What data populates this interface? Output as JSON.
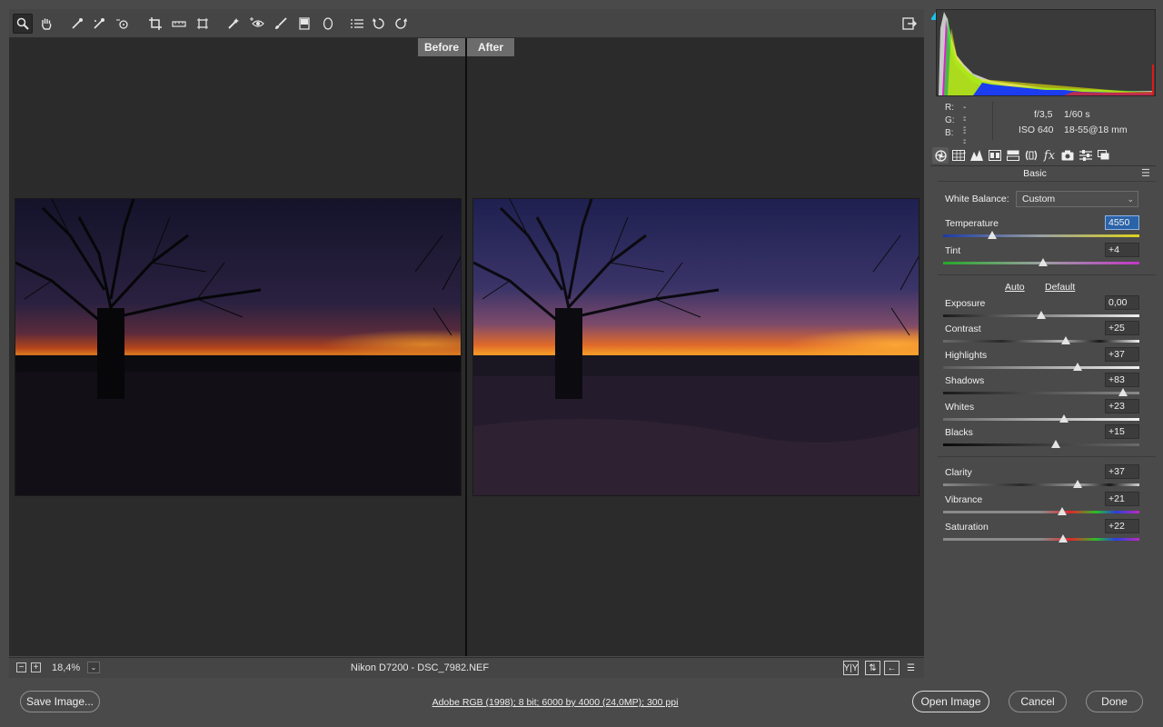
{
  "toolbar": {
    "tools": [
      {
        "name": "zoom-tool-icon",
        "glyph": "🔍",
        "active": true
      },
      {
        "name": "hand-tool-icon",
        "glyph": "✋"
      },
      {
        "name": "white-balance-tool-icon",
        "glyph": "⟋"
      },
      {
        "name": "color-sampler-tool-icon",
        "glyph": "⟋"
      },
      {
        "name": "targeted-adjustment-tool-icon",
        "glyph": "◎"
      },
      {
        "name": "crop-tool-icon",
        "glyph": "⌗"
      },
      {
        "name": "straighten-tool-icon",
        "glyph": "▭"
      },
      {
        "name": "transform-tool-icon",
        "glyph": "⬚"
      },
      {
        "name": "spot-removal-tool-icon",
        "glyph": "✎"
      },
      {
        "name": "red-eye-tool-icon",
        "glyph": "◉"
      },
      {
        "name": "adjustment-brush-icon",
        "glyph": "✐"
      },
      {
        "name": "graduated-filter-icon",
        "glyph": "▮"
      },
      {
        "name": "radial-filter-icon",
        "glyph": "◯"
      },
      {
        "name": "preferences-icon",
        "glyph": "☰"
      },
      {
        "name": "rotate-left-icon",
        "glyph": "↺"
      },
      {
        "name": "rotate-right-icon",
        "glyph": "↻"
      }
    ],
    "fullscreen_icon": "⇱"
  },
  "preview": {
    "before_label": "Before",
    "after_label": "After"
  },
  "statusbar": {
    "zoom_out": "−",
    "zoom_in": "+",
    "zoom_value": "18,4%",
    "zoom_dropdown": "⌄",
    "file_info": "Nikon D7200  -  DSC_7982.NEF",
    "view_buttons": [
      "Y|Y",
      "⇅",
      "←",
      "☰"
    ]
  },
  "camera": {
    "r_label": "R:",
    "r_value": "---",
    "g_label": "G:",
    "g_value": "---",
    "b_label": "B:",
    "b_value": "---",
    "aperture": "f/3,5",
    "shutter": "1/60 s",
    "iso": "ISO 640",
    "lens": "18-55@18 mm"
  },
  "panel": {
    "title": "Basic",
    "menu_icon": "☰",
    "tabs": [
      "basic-tab-icon",
      "tone-curve-tab-icon",
      "detail-tab-icon",
      "hsl-tab-icon",
      "split-toning-tab-icon",
      "lens-corrections-tab-icon",
      "effects-tab-icon",
      "camera-calibration-tab-icon",
      "presets-tab-icon",
      "snapshots-tab-icon"
    ],
    "white_balance_label": "White Balance:",
    "white_balance_value": "Custom",
    "auto_label": "Auto",
    "default_label": "Default",
    "sliders": {
      "temperature": {
        "label": "Temperature",
        "value": "4550",
        "pos": 0.25
      },
      "tint": {
        "label": "Tint",
        "value": "+4",
        "pos": 0.51
      },
      "exposure": {
        "label": "Exposure",
        "value": "0,00",
        "pos": 0.5
      },
      "contrast": {
        "label": "Contrast",
        "value": "+25",
        "pos": 0.625
      },
      "highlights": {
        "label": "Highlights",
        "value": "+37",
        "pos": 0.685
      },
      "shadows": {
        "label": "Shadows",
        "value": "+83",
        "pos": 0.915
      },
      "whites": {
        "label": "Whites",
        "value": "+23",
        "pos": 0.615
      },
      "blacks": {
        "label": "Blacks",
        "value": "+15",
        "pos": 0.575
      },
      "clarity": {
        "label": "Clarity",
        "value": "+37",
        "pos": 0.685
      },
      "vibrance": {
        "label": "Vibrance",
        "value": "+21",
        "pos": 0.605
      },
      "saturation": {
        "label": "Saturation",
        "value": "+22",
        "pos": 0.61
      }
    }
  },
  "bottom": {
    "save_label": "Save Image...",
    "workflow_text": "Adobe RGB (1998); 8 bit; 6000 by 4000 (24,0MP); 300 ppi",
    "open_label": "Open Image",
    "cancel_label": "Cancel",
    "done_label": "Done"
  },
  "colors": {
    "shadow_clip_warning": "#19c3e6",
    "highlight_clip_warning": "#e01818",
    "focus_blue": "#2a63a8"
  }
}
